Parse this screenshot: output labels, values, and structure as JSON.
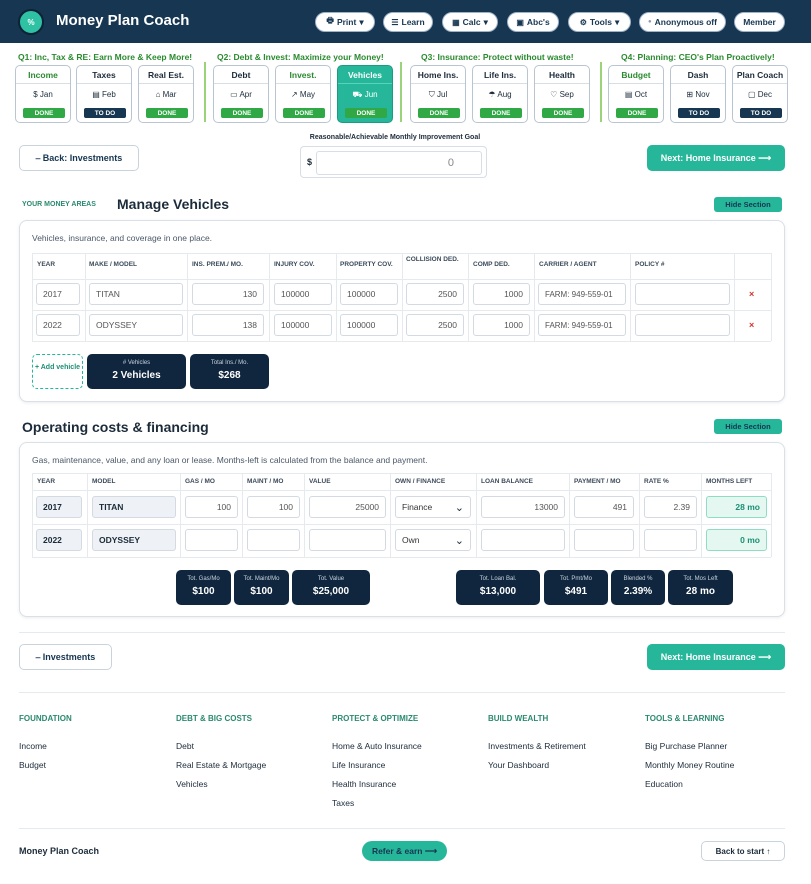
{
  "header": {
    "logo_text": "%",
    "brand": "Money Plan Coach",
    "buttons": [
      {
        "icon": "print-icon",
        "glyph": "🖶",
        "label": "Print",
        "caret": "▾"
      },
      {
        "icon": "book-icon",
        "glyph": "☰",
        "label": "Learn",
        "caret": ""
      },
      {
        "icon": "calculator-icon",
        "glyph": "▦",
        "label": "Calc",
        "caret": "▾"
      },
      {
        "icon": "abc-icon",
        "glyph": "▣",
        "label": "Abc's",
        "caret": ""
      },
      {
        "icon": "gear-icon",
        "glyph": "⚙",
        "label": "Tools",
        "caret": "▾"
      },
      {
        "icon": "dot-icon",
        "glyph": "●",
        "label": "Anonymous off",
        "caret": ""
      },
      {
        "icon": "",
        "glyph": "",
        "label": "Member",
        "caret": ""
      }
    ]
  },
  "quarters": [
    {
      "title": "Q1: Inc, Tax & RE: Earn More & Keep More!"
    },
    {
      "title": "Q2: Debt & Invest: Maximize your Money!"
    },
    {
      "title": "Q3: Insurance: Protect without waste!"
    },
    {
      "title": "Q4: Planning: CEO's Plan Proactively!"
    }
  ],
  "months": [
    {
      "label": "Income",
      "icon": "$",
      "month": "Jan",
      "status": "DONE"
    },
    {
      "label": "Taxes",
      "icon": "▤",
      "month": "Feb",
      "status": "TO DO"
    },
    {
      "label": "Real Est.",
      "icon": "⌂",
      "month": "Mar",
      "status": "DONE"
    },
    {
      "label": "Debt",
      "icon": "▭",
      "month": "Apr",
      "status": "DONE"
    },
    {
      "label": "Invest.",
      "icon": "↗",
      "month": "May",
      "status": "DONE"
    },
    {
      "label": "Vehicles",
      "icon": "⛟",
      "month": "Jun",
      "status": "DONE"
    },
    {
      "label": "Home Ins.",
      "icon": "⛉",
      "month": "Jul",
      "status": "DONE"
    },
    {
      "label": "Life Ins.",
      "icon": "☂",
      "month": "Aug",
      "status": "DONE"
    },
    {
      "label": "Health",
      "icon": "♡",
      "month": "Sep",
      "status": "DONE"
    },
    {
      "label": "Budget",
      "icon": "▤",
      "month": "Oct",
      "status": "DONE"
    },
    {
      "label": "Dash",
      "icon": "⊞",
      "month": "Nov",
      "status": "TO DO"
    },
    {
      "label": "Plan Coach",
      "icon": "▢",
      "month": "Dec",
      "status": "TO DO"
    }
  ],
  "nav": {
    "back_label": "⎯ Back: Investments",
    "next_label": "Next: Home Insurance ⟶",
    "goal_label": "Reasonable/Achievable Monthly Improvement Goal",
    "goal_currency": "$",
    "goal_value": "0"
  },
  "section1": {
    "eyebrow": "YOUR MONEY AREAS",
    "title": "Manage Vehicles",
    "hide_label": "Hide Section",
    "description": "Vehicles, insurance, and coverage in one place.",
    "headers": [
      "YEAR",
      "MAKE / MODEL",
      "INS. PREM./ MO.",
      "INJURY COV.",
      "PROPERTY COV.",
      "COLLISION DED.",
      "COMP DED.",
      "CARRIER / AGENT",
      "POLICY #"
    ],
    "rows": [
      {
        "year": "2017",
        "model": "TITAN",
        "premium": "130",
        "injury": "100000",
        "property": "100000",
        "collision": "2500",
        "comp": "1000",
        "carrier": "FARM: 949-559-01",
        "policy": ""
      },
      {
        "year": "2022",
        "model": "ODYSSEY",
        "premium": "138",
        "injury": "100000",
        "property": "100000",
        "collision": "2500",
        "comp": "1000",
        "carrier": "FARM: 949-559-01",
        "policy": ""
      }
    ],
    "delete_glyph": "×",
    "add_label": "+ Add vehicle",
    "stats": [
      {
        "label": "# Vehicles",
        "value": "2 Vehicles"
      },
      {
        "label": "Total Ins./ Mo.",
        "value": "$268"
      }
    ]
  },
  "section2": {
    "title": "Operating costs & financing",
    "hide_label": "Hide Section",
    "description": "Gas, maintenance, value, and any loan or lease. Months-left is calculated from the balance and payment.",
    "headers": [
      "YEAR",
      "MODEL",
      "GAS / MO",
      "MAINT / MO",
      "VALUE",
      "OWN / FINANCE",
      "LOAN BALANCE",
      "PAYMENT / MO",
      "RATE %",
      "MONTHS LEFT"
    ],
    "rows": [
      {
        "year": "2017",
        "model": "TITAN",
        "gas": "100",
        "maint": "100",
        "value": "25000",
        "own": "Finance",
        "loan": "13000",
        "payment": "491",
        "rate": "2.39",
        "months": "28 mo"
      },
      {
        "year": "2022",
        "model": "ODYSSEY",
        "gas": "",
        "maint": "",
        "value": "",
        "own": "Own",
        "loan": "",
        "payment": "",
        "rate": "",
        "months": "0 mo"
      }
    ],
    "stats_left": [
      {
        "label": "Tot. Gas/Mo",
        "value": "$100"
      },
      {
        "label": "Tot. Maint/Mo",
        "value": "$100"
      },
      {
        "label": "Tot. Value",
        "value": "$25,000"
      }
    ],
    "stats_right": [
      {
        "label": "Tot. Loan Bal.",
        "value": "$13,000"
      },
      {
        "label": "Tot. Pmt/Mo",
        "value": "$491"
      },
      {
        "label": "Blended %",
        "value": "2.39%"
      },
      {
        "label": "Tot. Mos Left",
        "value": "28 mo"
      }
    ]
  },
  "bottom_nav": {
    "back_label": "⎯ Investments",
    "next_label": "Next: Home Insurance ⟶"
  },
  "footer": {
    "columns": [
      {
        "heading": "FOUNDATION",
        "links": [
          "Income",
          "Budget"
        ]
      },
      {
        "heading": "DEBT & BIG COSTS",
        "links": [
          "Debt",
          "Real Estate & Mortgage",
          "Vehicles"
        ]
      },
      {
        "heading": "PROTECT & OPTIMIZE",
        "links": [
          "Home & Auto Insurance",
          "Life Insurance",
          "Health Insurance",
          "Taxes"
        ]
      },
      {
        "heading": "BUILD WEALTH",
        "links": [
          "Investments & Retirement",
          "Your Dashboard"
        ]
      },
      {
        "heading": "TOOLS & LEARNING",
        "links": [
          "Big Purchase Planner",
          "Monthly Money Routine",
          "Education"
        ]
      }
    ],
    "brand": "Money Plan Coach",
    "refer_label": "Refer & earn ⟶",
    "back_to_start": "Back to start ↑"
  },
  "colors": {
    "header_bg": "#163651",
    "accent": "#26b79b",
    "done": "#2fa845",
    "todo": "#163651",
    "delete": "#d2342f"
  }
}
